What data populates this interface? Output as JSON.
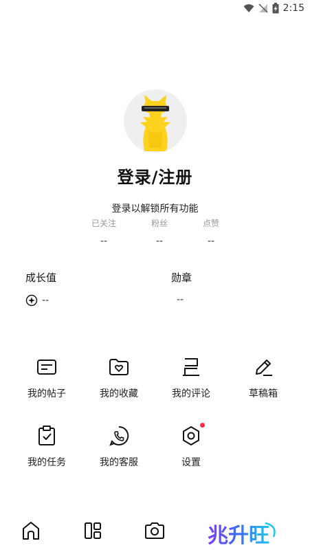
{
  "status_bar": {
    "time": "2:15",
    "icons": [
      "wifi-icon",
      "no-signal-icon",
      "battery-charging-icon"
    ]
  },
  "profile": {
    "avatar_icon": "yellow-cat-avatar",
    "title": "登录/注册",
    "subtitle": "登录以解锁所有功能"
  },
  "stats": [
    {
      "label": "已关注",
      "value": "--"
    },
    {
      "label": "粉丝",
      "value": "--"
    },
    {
      "label": "点赞",
      "value": "--"
    }
  ],
  "growth": {
    "label": "成长值",
    "value": "--",
    "icon": "growth-icon"
  },
  "medal": {
    "label": "勋章",
    "value": "--"
  },
  "menu": [
    {
      "label": "我的帖子",
      "icon": "post-icon"
    },
    {
      "label": "我的收藏",
      "icon": "favorite-folder-icon"
    },
    {
      "label": "我的评论",
      "icon": "comment-icon"
    },
    {
      "label": "草稿箱",
      "icon": "pencil-icon"
    },
    {
      "label": "我的任务",
      "icon": "task-clipboard-icon"
    },
    {
      "label": "我的客服",
      "icon": "customer-service-icon"
    },
    {
      "label": "设置",
      "icon": "settings-icon"
    }
  ],
  "tabbar": {
    "tabs": [
      "home-icon",
      "layout-icon",
      "camera-icon"
    ],
    "brand": "兆升旺"
  },
  "colors": {
    "accent_yellow": "#FFD21F",
    "badge_red": "#FF2D4A",
    "text_primary": "#111111",
    "text_muted": "#999999"
  }
}
